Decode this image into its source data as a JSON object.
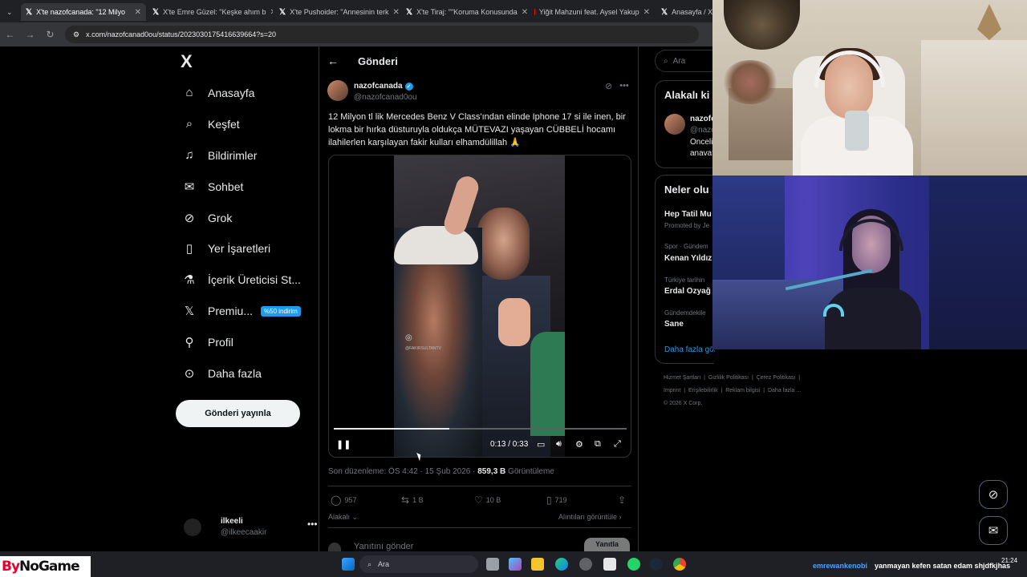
{
  "browser": {
    "tabs": [
      {
        "label": "X'te nazofcanada: \"12 Milyo",
        "active": true
      },
      {
        "label": "X'te Emre Güzel: \"Keşke ahım b"
      },
      {
        "label": "X'te Pushoider: \"Annesinin terk"
      },
      {
        "label": "X'te Tiraj: \"\"Koruma Konusunda"
      },
      {
        "label": "Yiğit Mahzuni feat. Aysel Yakup"
      },
      {
        "label": "Anasayfa / X"
      }
    ],
    "url": "x.com/nazofcanad0ou/status/2023030175416639664?s=20"
  },
  "left_nav": {
    "logo": "X",
    "items": [
      {
        "label": "Anasayfa",
        "icon": "home-icon"
      },
      {
        "label": "Keşfet",
        "icon": "search-icon"
      },
      {
        "label": "Bildirimler",
        "icon": "bell-icon"
      },
      {
        "label": "Sohbet",
        "icon": "mail-icon"
      },
      {
        "label": "Grok",
        "icon": "grok-icon"
      },
      {
        "label": "Yer İşaretleri",
        "icon": "bookmark-icon"
      },
      {
        "label": "İçerik Üreticisi St...",
        "icon": "creator-icon"
      },
      {
        "label": "Premiu...",
        "icon": "x-premium-icon"
      },
      {
        "label": "Profil",
        "icon": "person-icon"
      },
      {
        "label": "Daha fazla",
        "icon": "more-circle-icon"
      }
    ],
    "premium_badge": "%50 indirim",
    "post_button": "Gönderi yayınla",
    "account": {
      "name": "ilkeeli",
      "handle": "@ilkeecaakir"
    }
  },
  "post": {
    "header": "Gönderi",
    "author_name": "nazofcanada",
    "author_handle": "@nazofcanad0ou",
    "text": "12 Milyon tl lik Mercedes Benz V Class'ından elinde Iphone 17 si ile inen, bir lokma bir hırka düsturuyla oldukça MÜTEVAZI yaşayan CÜBBELİ hocamı ilahilerlen karşılayan fakir kulları elhamdülillah 🙏",
    "video": {
      "watermark": "@FAKIRSULTANTV",
      "time": "0:13 / 0:33",
      "progress": 0.394
    },
    "meta_prefix": "Son düzenleme: ÖS 4:42 · 15 Şub 2026 · ",
    "views": "859,3 B",
    "views_suffix": " Görüntüleme",
    "stats": {
      "replies": "957",
      "reposts": "1 B",
      "likes": "10 B",
      "bookmarks": "719"
    },
    "related": "Alakalı",
    "quotes": "Alıntıları görüntüle",
    "reply_placeholder": "Yanıtını gönder",
    "reply_button": "Yanıtla"
  },
  "right": {
    "search_placeholder": "Ara",
    "related_title": "Alakalı ki",
    "related_name": "nazofc",
    "related_handle": "@nazo",
    "related_bio_1": "Önceli",
    "related_bio_2": "anavat",
    "trends_title": "Neler olu",
    "trends": [
      {
        "small": "",
        "big": "Hep Tatil Mu",
        "promo": "Promoted by Je"
      },
      {
        "small": "Spor · Gündem",
        "big": "Kenan Yıldız"
      },
      {
        "small": "Türkiye tarihin",
        "big": "Erdal Özyağ"
      },
      {
        "small": "Gündemdekile",
        "big": "Sane"
      }
    ],
    "more": "Daha fazla göster",
    "footer": [
      "Hizmet Şartları",
      "Gizlilik Politikası",
      "Çerez Politikası",
      "Imprint",
      "Erişilebilirlik",
      "Reklam bilgisi",
      "Daha fazla ...",
      "© 2026 X Corp."
    ]
  },
  "taskbar": {
    "brand_by": "By",
    "brand_rest": "NoGame",
    "search": "Ara",
    "chat_name": "emrewankenobi",
    "chat_msg": "yanmayan kefen satan edam shjdfkjhas",
    "clock": "21:24"
  }
}
